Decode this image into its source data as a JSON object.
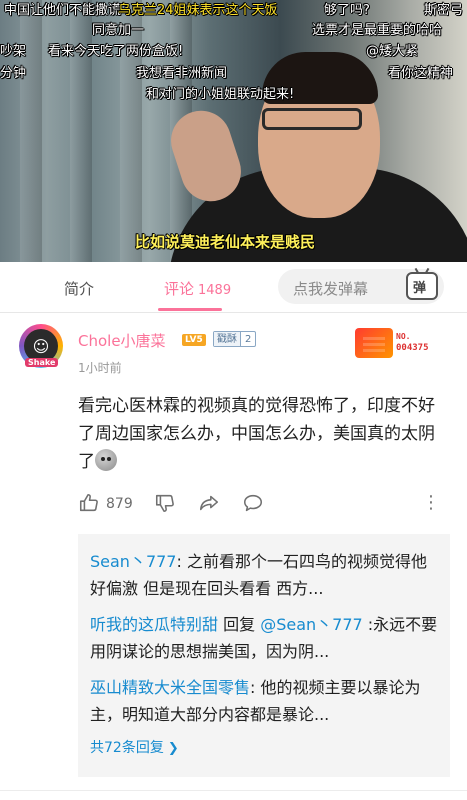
{
  "video": {
    "danmaku": [
      {
        "text": "中国让他们不能撒谎",
        "color": "white"
      },
      {
        "text": "乌克兰24姐妹表示这个天饭",
        "color": "yellow"
      },
      {
        "text": "够了吗?",
        "color": "white"
      },
      {
        "text": "斯密弓",
        "color": "white"
      },
      {
        "text": "同意加一",
        "color": "white"
      },
      {
        "text": "选票才是最重要的哈哈",
        "color": "white"
      },
      {
        "text": "吵架",
        "color": "white"
      },
      {
        "text": "看来今天吃了两份盒饭!",
        "color": "white"
      },
      {
        "text": "@矮大紧",
        "color": "white"
      },
      {
        "text": "分钟",
        "color": "white"
      },
      {
        "text": "我想看非洲新闻",
        "color": "white"
      },
      {
        "text": "看你这精神",
        "color": "white"
      },
      {
        "text": "和对门的小姐姐联动起来!",
        "color": "white"
      }
    ],
    "subtitle": "比如说莫迪老仙本来是贱民"
  },
  "tabs": {
    "intro_label": "简介",
    "comments_label": "评论",
    "comments_count": "1489",
    "danmu_placeholder": "点我发弹幕",
    "danmu_button_icon": "弹"
  },
  "comment": {
    "avatar_tag": "Shake",
    "username": "Chole小唐菜",
    "level": "LV5",
    "fan_badge_name": "戳酥",
    "fan_badge_level": "2",
    "time": "1小时前",
    "garb_no": "NO.",
    "garb_number": "004375",
    "text": "看完心医林霖的视频真的觉得恐怖了，印度不好了周边国家怎么办，中国怎么办，美国真的太阴了",
    "like_count": "879",
    "more_icon": "⋮"
  },
  "replies": {
    "items": [
      {
        "name": "Sean丶777",
        "sep": ":",
        "text": " 之前看那个一石四鸟的视频觉得他好偏激 但是现在回头看看 西方..."
      },
      {
        "name": "听我的这瓜特别甜",
        "mid": " 回复 ",
        "at": "@Sean丶777",
        "text": " :永远不要用阴谋论的思想揣美国，因为阴..."
      },
      {
        "name": "巫山精致大米全国零售",
        "sep": ":",
        "text": " 他的视频主要以暴论为主，明知道大部分内容都是暴论..."
      }
    ],
    "more_label": "共72条回复",
    "more_chevron": "❯"
  }
}
